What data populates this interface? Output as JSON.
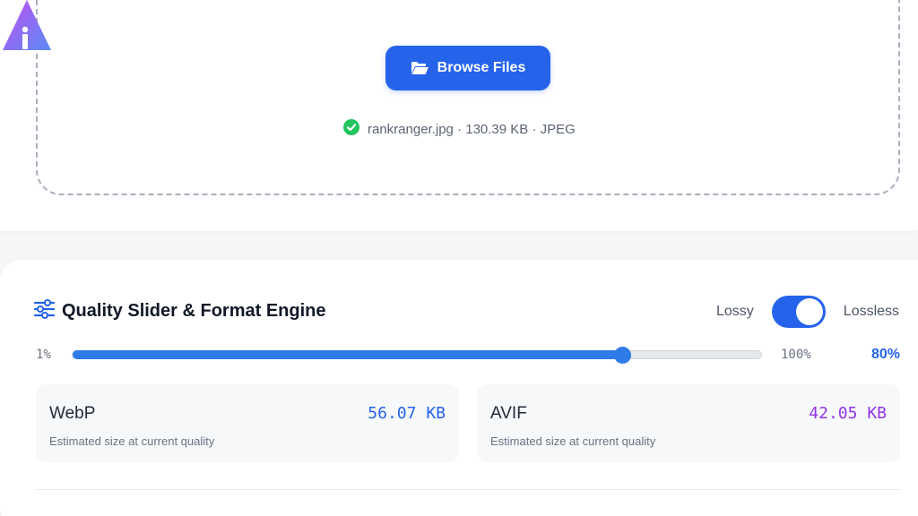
{
  "upload": {
    "browse_label": "Browse Files",
    "file_info": "rankranger.jpg · 130.39 KB · JPEG"
  },
  "quality": {
    "title": "Quality Slider & Format Engine",
    "mode_left": "Lossy",
    "mode_right": "Lossless",
    "toggle_state": "lossless",
    "range_min": "1%",
    "range_max": "100%",
    "value_label": "80%",
    "value": 80,
    "min": 1,
    "max": 100
  },
  "formats": [
    {
      "name": "WebP",
      "size": "56.07 KB",
      "note": "Estimated size at current quality",
      "color": "#2563eb"
    },
    {
      "name": "AVIF",
      "size": "42.05 KB",
      "note": "Estimated size at current quality",
      "color": "#9333ea"
    }
  ],
  "colors": {
    "accent": "#2563eb",
    "success": "#22c55e",
    "logo_start": "#a855f7",
    "logo_end": "#3b82f6"
  }
}
